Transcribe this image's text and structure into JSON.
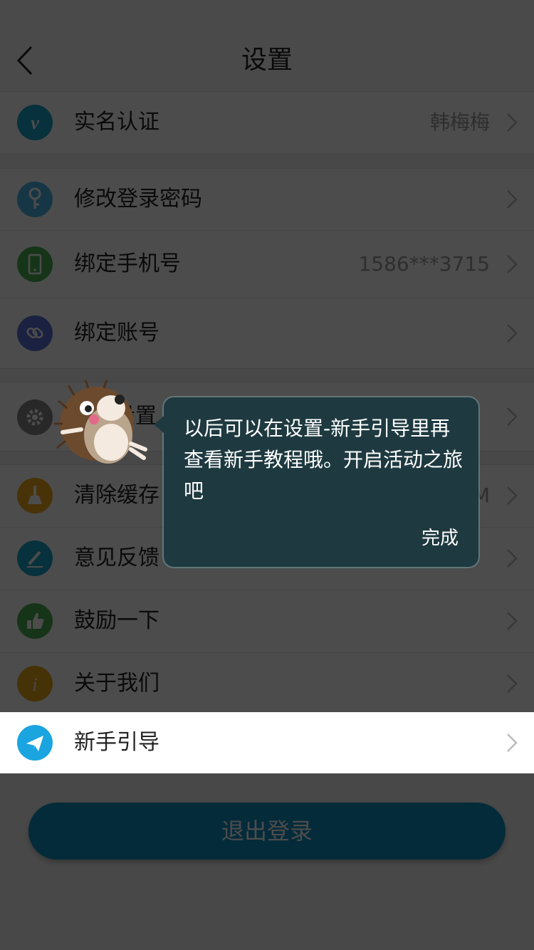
{
  "header": {
    "title": "设置"
  },
  "groups": [
    {
      "items": [
        {
          "label": "实名认证",
          "value": "韩梅梅",
          "icon": "verified-v-icon",
          "color": "#1aa5c8"
        }
      ]
    },
    {
      "items": [
        {
          "label": "修改登录密码",
          "value": "",
          "icon": "key-icon",
          "color": "#4bb6e8"
        },
        {
          "label": "绑定手机号",
          "value": "1586***3715",
          "icon": "phone-icon",
          "color": "#4caf50"
        },
        {
          "label": "绑定账号",
          "value": "",
          "icon": "link-icon",
          "color": "#5a6fd6"
        }
      ]
    },
    {
      "items": [
        {
          "label": "设置",
          "value": "",
          "icon": "gear-icon",
          "color": "#888888"
        }
      ]
    },
    {
      "items": [
        {
          "label": "清除缓存",
          "value": "3M",
          "icon": "broom-icon",
          "color": "#f0a818"
        },
        {
          "label": "意见反馈",
          "value": "",
          "icon": "pencil-icon",
          "color": "#1aa5c8"
        },
        {
          "label": "鼓励一下",
          "value": "",
          "icon": "thumbs-up-icon",
          "color": "#4caf50"
        },
        {
          "label": "关于我们",
          "value": "",
          "icon": "info-icon",
          "color": "#e8a818"
        },
        {
          "label": "新手引导",
          "value": "",
          "icon": "paper-plane-icon",
          "color": "#1aa5e0"
        }
      ]
    }
  ],
  "logout": {
    "label": "退出登录"
  },
  "tooltip": {
    "text": "以后可以在设置-新手引导里再查看新手教程哦。开启活动之旅吧",
    "done_label": "完成"
  }
}
